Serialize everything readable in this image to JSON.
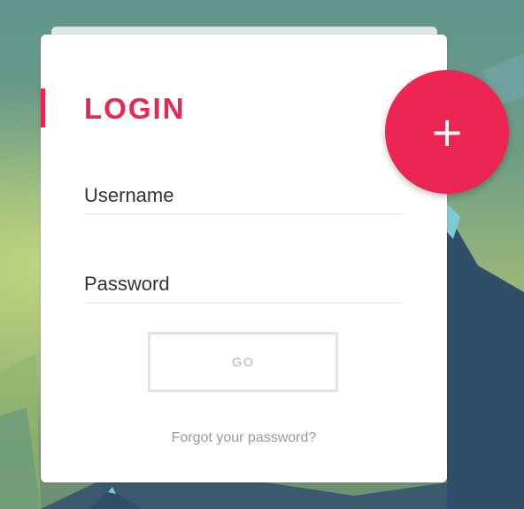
{
  "login": {
    "title": "LOGIN",
    "username_placeholder": "Username",
    "password_placeholder": "Password",
    "submit_label": "GO",
    "forgot_link": "Forgot your password?"
  },
  "fab": {
    "symbol": "+",
    "icon": "plus-icon"
  },
  "colors": {
    "accent": "#ed2553",
    "card": "#ffffff",
    "button_border": "#e3e3e3",
    "mountain": "#2f4f69"
  }
}
